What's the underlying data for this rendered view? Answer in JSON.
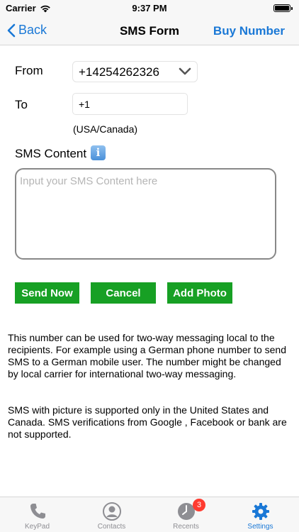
{
  "status_bar": {
    "carrier": "Carrier",
    "time": "9:37 PM"
  },
  "nav": {
    "back_label": "Back",
    "title": "SMS Form",
    "right_action": "Buy Number"
  },
  "form": {
    "from_label": "From",
    "from_value": "+14254262326",
    "to_label": "To",
    "to_value": "+1",
    "country_hint": "(USA/Canada)",
    "content_label": "SMS Content",
    "content_placeholder": "Input your SMS Content here"
  },
  "buttons": {
    "send": "Send Now",
    "cancel": "Cancel",
    "add_photo": "Add Photo"
  },
  "info": {
    "paragraph_1": " This number can be used for two-way messaging local to the recipients. For example using a German phone number to send SMS to a German mobile user. The number might be changed by local carrier for international two-way messaging.",
    "paragraph_2": " SMS with picture is supported only in the United States and Canada. SMS verifications from Google , Facebook or bank are not supported."
  },
  "tab_bar": {
    "items": [
      {
        "label": "KeyPad",
        "icon": "phone-icon",
        "active": false
      },
      {
        "label": "Contacts",
        "icon": "contact-icon",
        "active": false
      },
      {
        "label": "Recents",
        "icon": "clock-icon",
        "active": false,
        "badge": "3"
      },
      {
        "label": "Settings",
        "icon": "gear-icon",
        "active": true
      }
    ]
  },
  "colors": {
    "accent": "#1a78d6",
    "button_green": "#17a024",
    "badge_red": "#ff3b30"
  }
}
